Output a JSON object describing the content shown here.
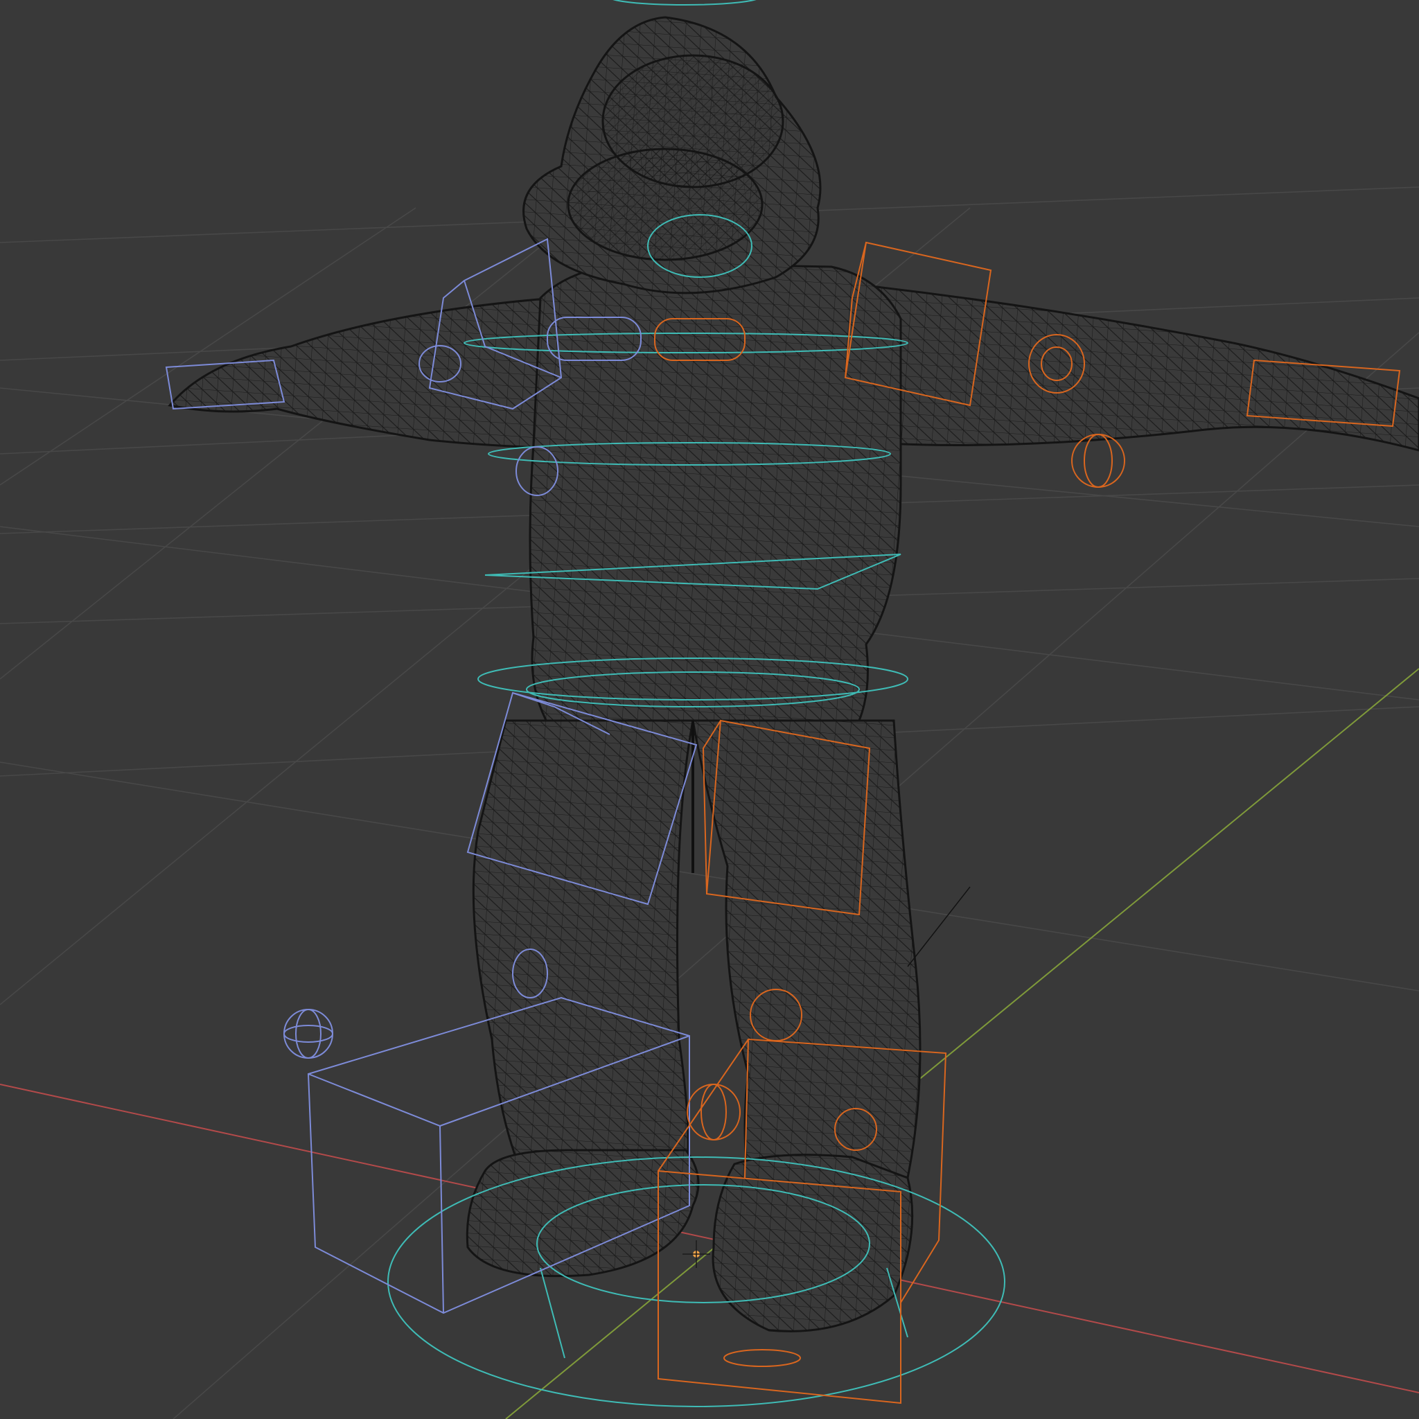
{
  "viewport": {
    "shading": "wireframe",
    "background": "#393939",
    "grid": {
      "visible": true,
      "line_color": "#484848"
    },
    "axes": {
      "x_axis_color": "#b34a4a",
      "y_axis_color": "#7f9a3a"
    }
  },
  "scene": {
    "mesh": {
      "name": "character-mesh",
      "wire_color": "#141414",
      "pose": "T-pose"
    },
    "rig": {
      "left_side_color": "#7d8bd8",
      "right_side_color": "#d9661f",
      "center_color": "#3fbcb6",
      "selected_pivot_color": "#f2a44a"
    },
    "icons": [
      "grid-icon",
      "axis-icon",
      "cube-widget-icon",
      "circle-widget-icon",
      "sphere-widget-icon"
    ]
  }
}
